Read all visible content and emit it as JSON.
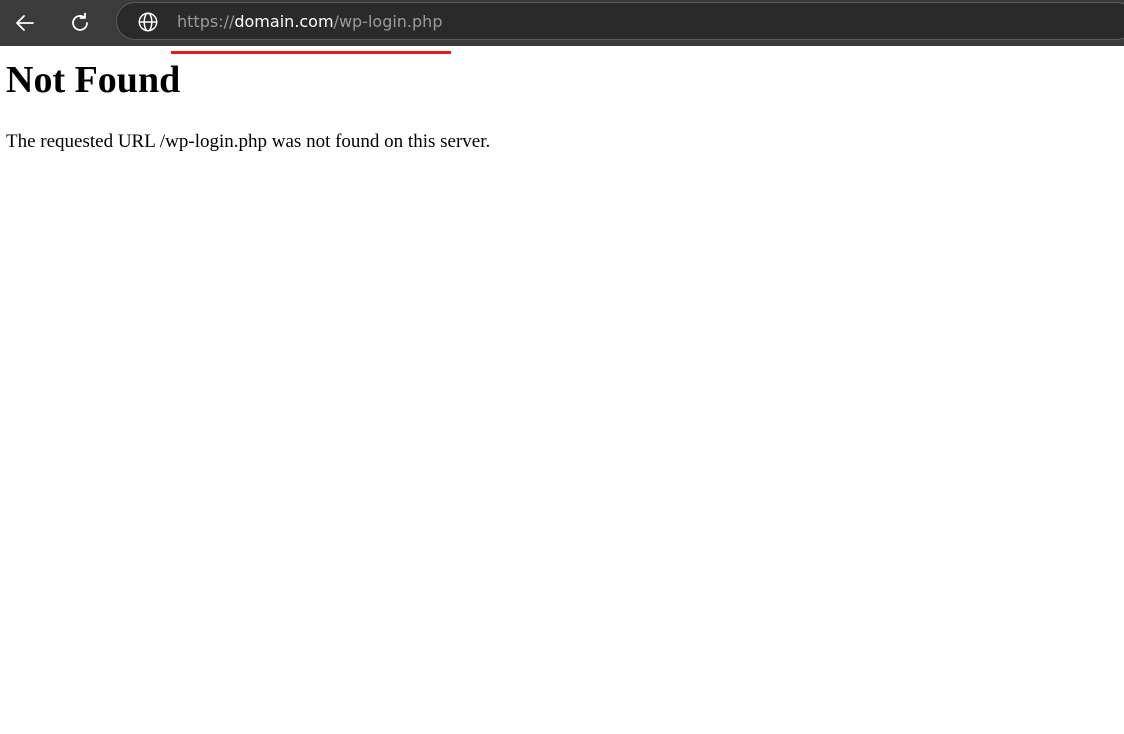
{
  "browser": {
    "url_scheme": "https://",
    "url_host": "domain.com",
    "url_path": "/wp-login.php",
    "icons": {
      "back": "back-arrow-icon",
      "reload": "reload-icon",
      "site": "globe-icon"
    },
    "accent_underline_color": "#e21b1b"
  },
  "page": {
    "heading": "Not Found",
    "message": "The requested URL /wp-login.php was not found on this server."
  }
}
